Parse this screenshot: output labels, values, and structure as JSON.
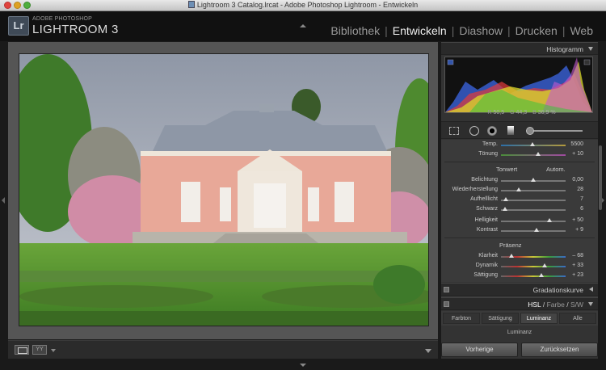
{
  "window": {
    "title": "Lightroom 3 Catalog.lrcat - Adobe Photoshop Lightroom - Entwickeln"
  },
  "header": {
    "logo": "Lr",
    "brand_small": "ADOBE PHOTOSHOP",
    "brand_big": "LIGHTROOM 3",
    "modules": [
      "Bibliothek",
      "Entwickeln",
      "Diashow",
      "Drucken",
      "Web"
    ],
    "active_module": "Entwickeln"
  },
  "histogram": {
    "title": "Histogramm",
    "r_label": "R",
    "r_value": "50,5",
    "g_label": "G",
    "g_value": "44,3",
    "b_label": "B",
    "b_value": "36,9",
    "unit": "%"
  },
  "basic": {
    "temp_label": "Temp.",
    "temp_value": "5500",
    "tint_label": "Tönung",
    "tint_value": "+ 10",
    "tone_label": "Tonwert",
    "auto_label": "Autom.",
    "sliders_tone": [
      {
        "label": "Belichtung",
        "value": "0,00",
        "level": 0.5
      },
      {
        "label": "Wiederherstellung",
        "value": "28",
        "level": 0.28
      },
      {
        "label": "Aufhelllicht",
        "value": "7",
        "level": 0.07
      },
      {
        "label": "Schwarz",
        "value": "6",
        "level": 0.06
      }
    ],
    "sliders_light": [
      {
        "label": "Helligkeit",
        "value": "+ 50",
        "level": 0.75
      },
      {
        "label": "Kontrast",
        "value": "+ 9",
        "level": 0.55
      }
    ],
    "presence_label": "Präsenz",
    "sliders_presence": [
      {
        "label": "Klarheit",
        "value": "– 68",
        "level": 0.16
      },
      {
        "label": "Dynamik",
        "value": "+ 33",
        "level": 0.67
      },
      {
        "label": "Sättigung",
        "value": "+ 23",
        "level": 0.62
      }
    ]
  },
  "panels": {
    "curve": "Gradationskurve",
    "hsl_title": "HSL",
    "hsl_sep": "/",
    "hsl_color": "Farbe",
    "hsl_bw": "S/W",
    "hsl_tabs": [
      "Farbton",
      "Sättigung",
      "Luminanz",
      "Alle"
    ],
    "hsl_active": "Luminanz",
    "luminance_label": "Luminanz"
  },
  "toolbar": {
    "before_after": "YY"
  },
  "buttons": {
    "previous": "Vorherige",
    "reset": "Zurücksetzen"
  },
  "colors": {
    "accent": "#eeeeee",
    "panel": "#333333",
    "background": "#1a1a1a"
  }
}
